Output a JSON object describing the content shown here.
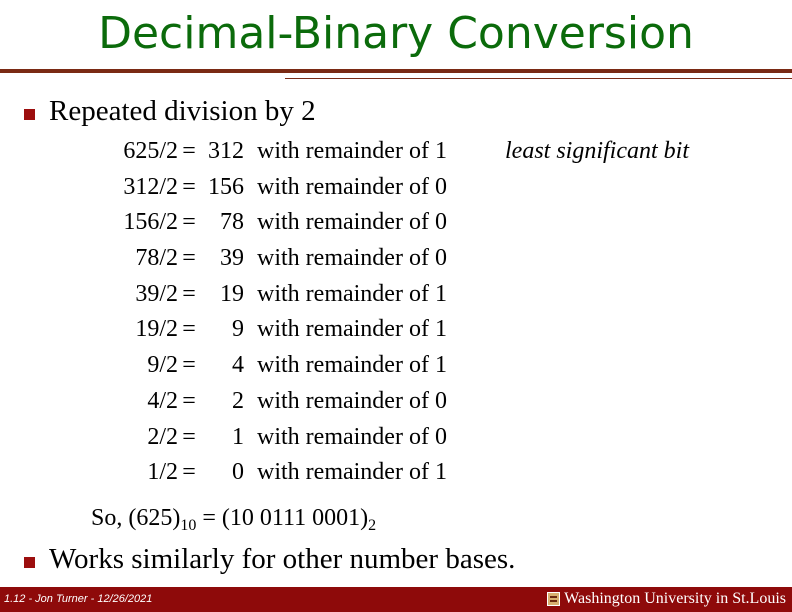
{
  "slide": {
    "title": "Decimal-Binary Conversion",
    "bullet1": "Repeated division by 2",
    "rows": [
      {
        "dividend": "625/2",
        "quotient": "312",
        "remainder": "with remainder of 1"
      },
      {
        "dividend": "312/2",
        "quotient": "156",
        "remainder": "with remainder of 0"
      },
      {
        "dividend": "156/2",
        "quotient": "78",
        "remainder": "with remainder of 0"
      },
      {
        "dividend": "78/2",
        "quotient": "39",
        "remainder": "with remainder of 0"
      },
      {
        "dividend": "39/2",
        "quotient": "19",
        "remainder": "with remainder of 1"
      },
      {
        "dividend": "19/2",
        "quotient": "9",
        "remainder": "with remainder of 1"
      },
      {
        "dividend": "9/2",
        "quotient": "4",
        "remainder": "with remainder of 1"
      },
      {
        "dividend": "4/2",
        "quotient": "2",
        "remainder": "with remainder of 0"
      },
      {
        "dividend": "2/2",
        "quotient": "1",
        "remainder": "with remainder of 0"
      },
      {
        "dividend": "1/2",
        "quotient": "0",
        "remainder": "with remainder of 1"
      }
    ],
    "equals": "=",
    "annotation": "least significant bit",
    "result": {
      "prefix": "So, (625)",
      "base_from": "10",
      "middle": " = (10 0111 0001)",
      "base_to": "2"
    },
    "bullet2": "Works similarly for other number bases."
  },
  "footer": {
    "left": "1.12 - Jon Turner - 12/26/2021",
    "right": "Washington University in St.Louis"
  },
  "colors": {
    "title": "#0b6b0b",
    "rule": "#7a2a14",
    "bullet": "#9c0e0e",
    "footer_bg": "#8e0a0a"
  }
}
